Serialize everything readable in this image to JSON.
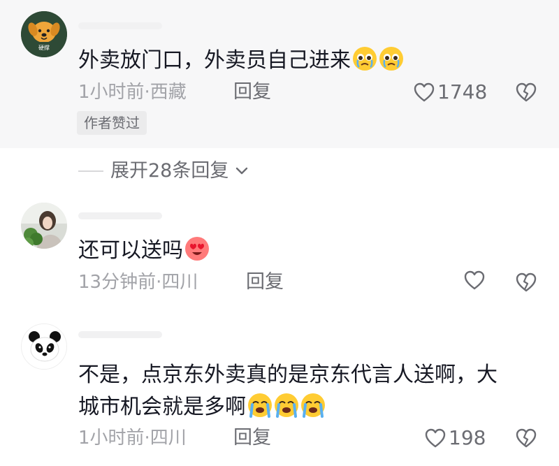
{
  "colors": {
    "text": "#161823",
    "meta": "#a2a3a8",
    "secondary": "#6b6c72",
    "highlight_bg": "#f7f7f8",
    "badge_bg": "#ebebec"
  },
  "comments": [
    {
      "avatar": "dog-avatar",
      "avatar_text": "硬撑",
      "text": "外卖放门口，外卖员自己进来",
      "emojis": [
        "pleading-face-emoji",
        "pleading-face-emoji"
      ],
      "meta": "1小时前·西藏",
      "reply_label": "回复",
      "likes": "1748",
      "badge": "作者赞过"
    },
    {
      "avatar": "photo-avatar",
      "text": "还可以送吗",
      "emojis": [
        "heart-eyes-emoji"
      ],
      "meta": "13分钟前·四川",
      "reply_label": "回复",
      "likes": ""
    },
    {
      "avatar": "panda-avatar",
      "text": "不是，点京东外卖真的是京东代言人送啊，大城市机会就是多啊",
      "emojis": [
        "crying-face-emoji",
        "crying-face-emoji",
        "crying-face-emoji"
      ],
      "meta": "1小时前·四川",
      "reply_label": "回复",
      "likes": "198"
    }
  ],
  "expand_label": "展开28条回复",
  "icons": [
    "heart-icon",
    "broken-heart-icon",
    "chevron-down-icon"
  ]
}
